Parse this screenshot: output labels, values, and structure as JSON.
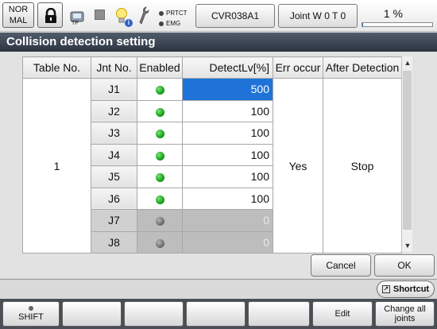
{
  "topbar": {
    "mode_line1": "NOR",
    "mode_line2": "MAL",
    "tp_label": "TP",
    "info_badge": "i",
    "prtct_label": "PRTCT",
    "emg_label": "EMG",
    "program_button": "CVR038A1",
    "coord_button": "Joint  W 0 T 0",
    "speed_text": "1 %",
    "speed_value_percent": 1
  },
  "title": "Collision detection setting",
  "table": {
    "headers": [
      "Table No.",
      "Jnt No.",
      "Enabled",
      "DetectLv[%]",
      "Err occur",
      "After Detection"
    ],
    "table_no": "1",
    "err_occur": "Yes",
    "after_detection": "Stop",
    "rows": [
      {
        "jnt": "J1",
        "enabled": true,
        "level": "500",
        "selected": true
      },
      {
        "jnt": "J2",
        "enabled": true,
        "level": "100"
      },
      {
        "jnt": "J3",
        "enabled": true,
        "level": "100"
      },
      {
        "jnt": "J4",
        "enabled": true,
        "level": "100"
      },
      {
        "jnt": "J5",
        "enabled": true,
        "level": "100"
      },
      {
        "jnt": "J6",
        "enabled": true,
        "level": "100"
      },
      {
        "jnt": "J7",
        "enabled": false,
        "level": "0"
      },
      {
        "jnt": "J8",
        "enabled": false,
        "level": "0"
      }
    ]
  },
  "buttons": {
    "cancel": "Cancel",
    "ok": "OK",
    "shortcut": "Shortcut"
  },
  "function_keys": {
    "shift": "SHIFT",
    "f2": "",
    "f3": "",
    "f4": "",
    "f5": "",
    "edit": "Edit",
    "change_all_line1": "Change all",
    "change_all_line2": "joints"
  },
  "colors": {
    "selected_cell": "#1f73d8",
    "enabled_led": "#15a315",
    "title_bar": "#3a434f"
  }
}
